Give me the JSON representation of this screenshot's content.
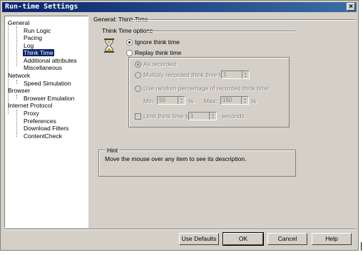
{
  "window": {
    "title": "Run-time Settings",
    "close_label": "×"
  },
  "tree": {
    "items": [
      {
        "label": "General",
        "level": 0
      },
      {
        "label": "Run Logic",
        "level": 1
      },
      {
        "label": "Pacing",
        "level": 1
      },
      {
        "label": "Log",
        "level": 1
      },
      {
        "label": "Think Time",
        "level": 1,
        "selected": true
      },
      {
        "label": "Additional attributes",
        "level": 1
      },
      {
        "label": "Miscellaneous",
        "level": 1
      },
      {
        "label": "Network",
        "level": 0
      },
      {
        "label": "Speed Simulation",
        "level": 1
      },
      {
        "label": "Browser",
        "level": 0
      },
      {
        "label": "Browser Emulation",
        "level": 1
      },
      {
        "label": "Internet Protocol",
        "level": 0
      },
      {
        "label": "Proxy",
        "level": 1
      },
      {
        "label": "Preferences",
        "level": 1
      },
      {
        "label": "Download Filters",
        "level": 1
      },
      {
        "label": "ContentCheck",
        "level": 1
      }
    ]
  },
  "panel": {
    "title": "General: Think Time",
    "section_label": "Think Time options",
    "ignore_label": "Ignore think time",
    "replay_label": "Replay think time",
    "as_recorded_label": "As recorded",
    "multiply_label": "Multiply recorded think time by:",
    "multiply_value": "1",
    "random_label": "Use random percentage of recorded think time:",
    "min_label": "Min:",
    "min_value": "50",
    "max_label": "Max:",
    "max_value": "150",
    "percent": "%",
    "limit_label": "Limit think time to:",
    "limit_value": "1",
    "seconds_label": "seconds"
  },
  "hint": {
    "title": "Hint",
    "text": "Move the mouse over any item to see its description."
  },
  "buttons": {
    "use_defaults": "Use Defaults",
    "ok": "OK",
    "cancel": "Cancel",
    "help": "Help"
  }
}
